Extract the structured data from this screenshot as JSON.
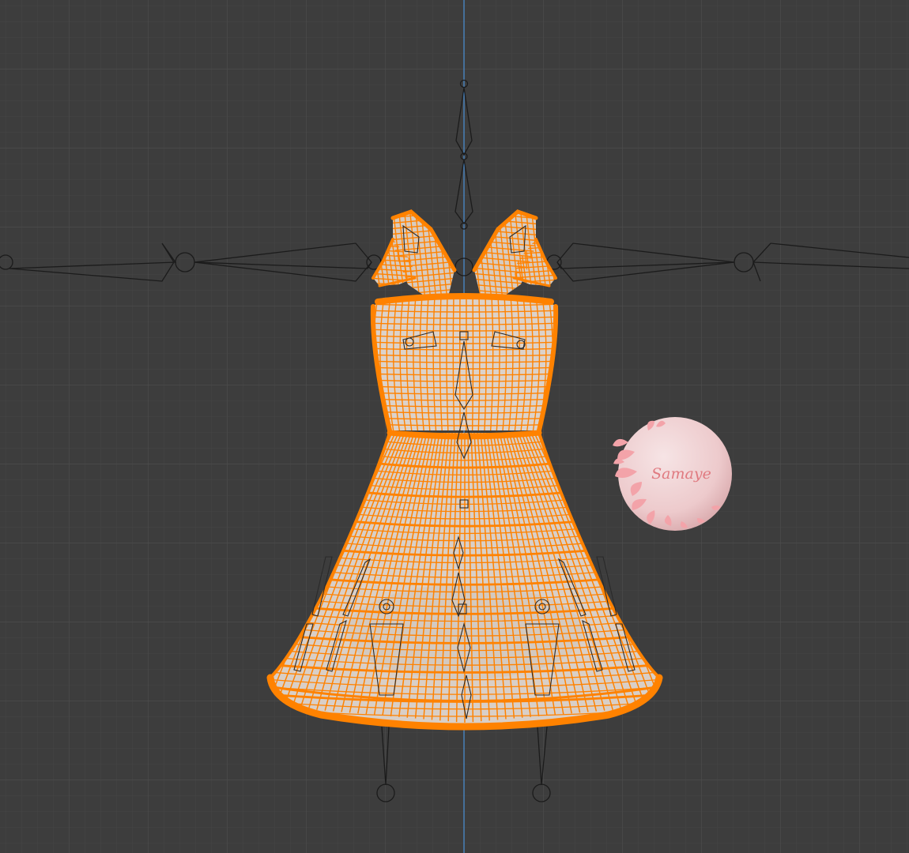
{
  "viewport": {
    "background": "#3d3d3d",
    "grid_minor_color": "#454545",
    "grid_major_color": "#4d4d4d",
    "center_axis_color": "#4a8fd6",
    "mode": "wireframe"
  },
  "mesh": {
    "object": "dress",
    "selected": true,
    "wire_color": "#ff8200",
    "fill_color": "#d9cfc7"
  },
  "armature": {
    "object": "armature",
    "bone_color": "#1b1b1b",
    "display": "octahedral"
  },
  "watermark": {
    "text": "Samaye",
    "text_color": "#e07a80",
    "badge_color": "#f2d2d4",
    "butterfly_color": "#f3a3a9",
    "icon": "butterfly-icon"
  }
}
